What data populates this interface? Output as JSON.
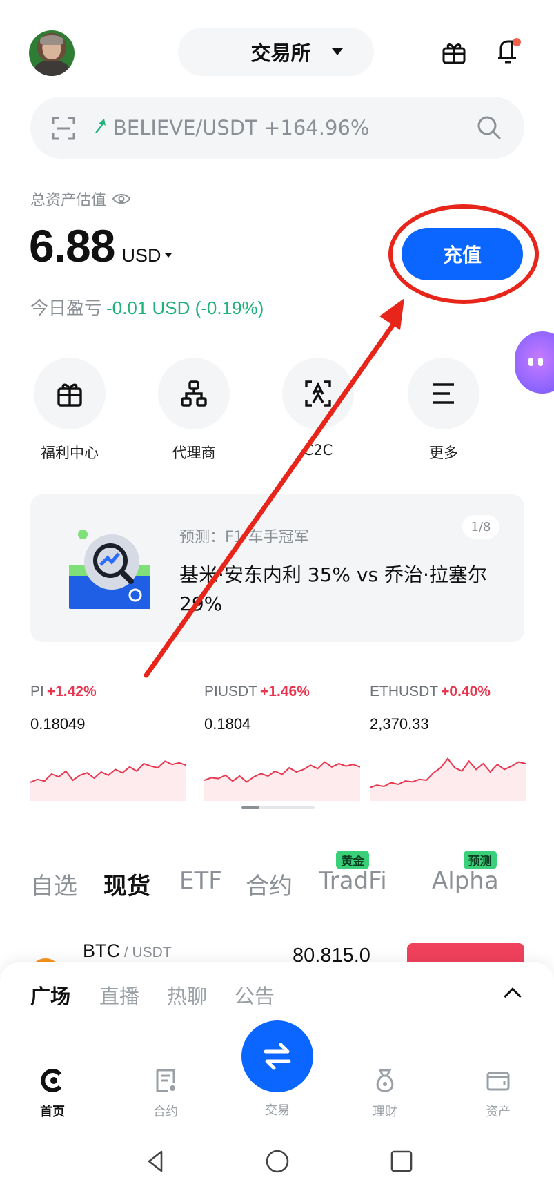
{
  "header": {
    "exchange_label": "交易所"
  },
  "search": {
    "trending_text": "BELIEVE/USDT +164.96%"
  },
  "assets": {
    "label": "总资产估值",
    "value": "6.88",
    "currency": "USD",
    "pnl_label": "今日盈亏",
    "pnl_value": "-0.01 USD (-0.19%)",
    "deposit_label": "充值"
  },
  "quick_actions": [
    {
      "label": "福利中心",
      "icon": "gift-icon"
    },
    {
      "label": "代理商",
      "icon": "agent-network-icon"
    },
    {
      "label": "C2C",
      "icon": "c2c-icon"
    },
    {
      "label": "更多",
      "icon": "menu-icon"
    }
  ],
  "banner": {
    "subtitle": "预测：F1 车手冠军",
    "title": "基米·安东内利 35% vs 乔治·拉塞尔 29%",
    "page": "1/8"
  },
  "tickers": [
    {
      "symbol": "PI",
      "change": "+1.42%",
      "price": "0.18049",
      "spark": [
        0.35,
        0.42,
        0.38,
        0.55,
        0.48,
        0.62,
        0.4,
        0.52,
        0.58,
        0.45,
        0.6,
        0.52,
        0.66,
        0.58,
        0.72,
        0.62,
        0.8,
        0.74,
        0.7,
        0.86,
        0.78,
        0.82,
        0.76
      ]
    },
    {
      "symbol": "PIUSDT",
      "change": "+1.46%",
      "price": "0.1804",
      "spark": [
        0.4,
        0.46,
        0.44,
        0.52,
        0.38,
        0.5,
        0.36,
        0.48,
        0.56,
        0.5,
        0.62,
        0.54,
        0.7,
        0.6,
        0.66,
        0.76,
        0.68,
        0.84,
        0.72,
        0.8,
        0.74,
        0.78,
        0.72
      ]
    },
    {
      "symbol": "ETHUSDT",
      "change": "+0.40%",
      "price": "2,370.33",
      "spark": [
        0.22,
        0.28,
        0.25,
        0.34,
        0.3,
        0.38,
        0.36,
        0.42,
        0.4,
        0.58,
        0.7,
        0.92,
        0.7,
        0.62,
        0.86,
        0.66,
        0.8,
        0.6,
        0.78,
        0.66,
        0.74,
        0.84,
        0.8
      ]
    }
  ],
  "market_tabs": [
    {
      "label": "自选",
      "tag": ""
    },
    {
      "label": "现货",
      "tag": ""
    },
    {
      "label": "ETF",
      "tag": ""
    },
    {
      "label": "合约",
      "tag": ""
    },
    {
      "label": "TradFi",
      "tag": "黄金"
    },
    {
      "label": "Alpha",
      "tag": "预测"
    }
  ],
  "peek_row": {
    "base": "BTC",
    "quote": " / USDT",
    "price": "80,815.0"
  },
  "sheet_tabs": [
    "广场",
    "直播",
    "热聊",
    "公告"
  ],
  "bottom_nav": [
    {
      "label": "首页",
      "icon": "home-icon"
    },
    {
      "label": "合约",
      "icon": "futures-icon"
    },
    {
      "label": "交易",
      "icon": "trade-swap-icon"
    },
    {
      "label": "理财",
      "icon": "earn-icon"
    },
    {
      "label": "资产",
      "icon": "wallet-icon"
    }
  ],
  "colors": {
    "brand_blue": "#0a66ff",
    "up_red": "#e8364f",
    "pnl_green": "#1fb17a",
    "annotation_red": "#e8251a"
  }
}
